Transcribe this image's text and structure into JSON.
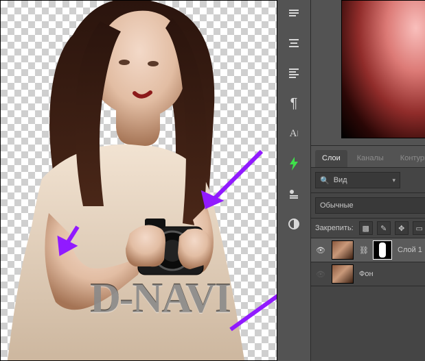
{
  "watermark": "D-NAVI",
  "tabs": {
    "layers": "Слои",
    "channels": "Каналы",
    "paths": "Контуры",
    "active": "layers"
  },
  "search": {
    "label": "Вид"
  },
  "blend": {
    "mode": "Обычные"
  },
  "lock": {
    "label": "Закрепить:"
  },
  "layers_list": [
    {
      "name": "Слой 1",
      "visible": true,
      "has_mask": true,
      "linked": true,
      "active": true
    },
    {
      "name": "Фон",
      "visible": false,
      "has_mask": false,
      "linked": false,
      "active": false
    }
  ],
  "toolbar_icons": [
    "zoom-icon",
    "align-icon",
    "paragraph-top-icon",
    "pilcrow-icon",
    "character-icon",
    "flash-icon",
    "brush-settings-icon",
    "circle-contrast-icon"
  ]
}
